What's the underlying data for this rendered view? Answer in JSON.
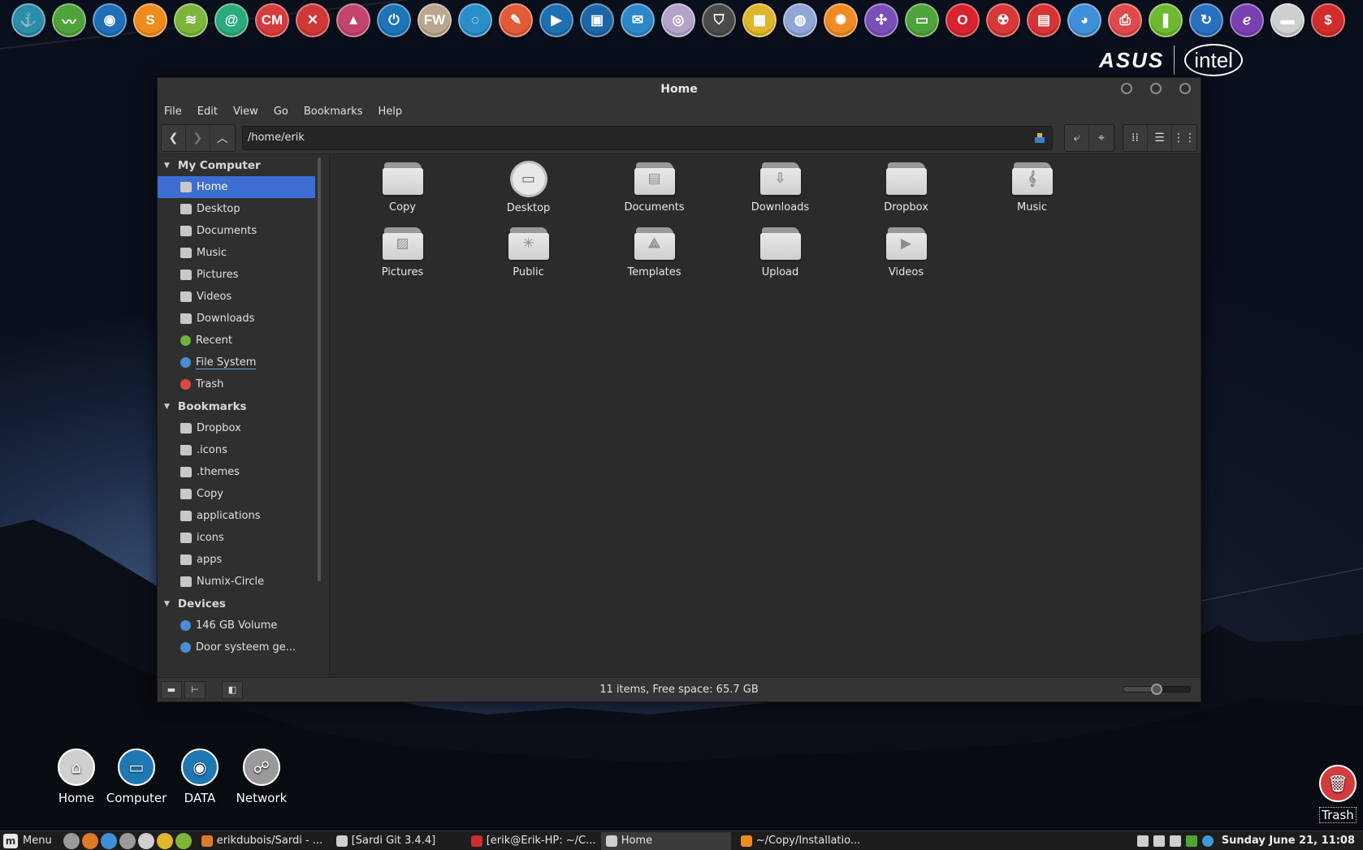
{
  "dock": {
    "icons": [
      {
        "name": "anchor-icon",
        "glyph": "⚓",
        "color": "#2b8da8"
      },
      {
        "name": "system-monitor-icon",
        "glyph": "〰",
        "color": "#4fa33b"
      },
      {
        "name": "firefox-icon",
        "glyph": "◉",
        "color": "#1e6fb8"
      },
      {
        "name": "sublime-icon",
        "glyph": "S",
        "color": "#f08a1d"
      },
      {
        "name": "spotify-icon",
        "glyph": "≋",
        "color": "#7db53c"
      },
      {
        "name": "mail-icon",
        "glyph": "@",
        "color": "#2bab7c"
      },
      {
        "name": "cm-icon",
        "glyph": "CM",
        "color": "#d83b3b"
      },
      {
        "name": "tools-icon",
        "glyph": "✕",
        "color": "#d03838"
      },
      {
        "name": "inkscape-icon",
        "glyph": "▲",
        "color": "#c0446b"
      },
      {
        "name": "power-icon",
        "glyph": "⏻",
        "color": "#1e74b8"
      },
      {
        "name": "fw-icon",
        "glyph": "FW",
        "color": "#b8a68e"
      },
      {
        "name": "dotted-circle-icon",
        "glyph": "◌",
        "color": "#2a8ec9"
      },
      {
        "name": "pencil-icon",
        "glyph": "✎",
        "color": "#e05b36"
      },
      {
        "name": "video-editor-icon",
        "glyph": "▶",
        "color": "#1f6fb3"
      },
      {
        "name": "image-viewer-icon",
        "glyph": "▣",
        "color": "#1d66a6"
      },
      {
        "name": "thunderbird-icon",
        "glyph": "✉",
        "color": "#2c88c9"
      },
      {
        "name": "disc-icon",
        "glyph": "◎",
        "color": "#b3a3c9"
      },
      {
        "name": "shield-icon",
        "glyph": "⛉",
        "color": "#4a4a4a"
      },
      {
        "name": "ruler-icon",
        "glyph": "▦",
        "color": "#e0b62a"
      },
      {
        "name": "globe-icon",
        "glyph": "◍",
        "color": "#8fa6d6"
      },
      {
        "name": "orange-wheel-icon",
        "glyph": "✺",
        "color": "#ef8b23"
      },
      {
        "name": "compass-icon",
        "glyph": "✣",
        "color": "#7a4fb8"
      },
      {
        "name": "card-icon",
        "glyph": "▭",
        "color": "#4ea33a"
      },
      {
        "name": "opera-icon",
        "glyph": "O",
        "color": "#d8232f"
      },
      {
        "name": "radiation-icon",
        "glyph": "☢",
        "color": "#d83838"
      },
      {
        "name": "grid-apps-icon",
        "glyph": "▤",
        "color": "#d63333"
      },
      {
        "name": "chrome-icon",
        "glyph": "◕",
        "color": "#3f8fd8"
      },
      {
        "name": "printer-icon",
        "glyph": "⎙",
        "color": "#e04a4a"
      },
      {
        "name": "book-icon",
        "glyph": "❚",
        "color": "#6fb832"
      },
      {
        "name": "refresh-icon",
        "glyph": "↻",
        "color": "#2a6fc0"
      },
      {
        "name": "emacs-icon",
        "glyph": "ℯ",
        "color": "#7a3fb0"
      },
      {
        "name": "folder-dock-icon",
        "glyph": "▬",
        "color": "#cfcfcf"
      },
      {
        "name": "terminal-dollar-icon",
        "glyph": "$",
        "color": "#d02c2c"
      }
    ]
  },
  "brand": {
    "asus": "ASUS",
    "intel": "intel"
  },
  "window": {
    "title": "Home",
    "menu": [
      "File",
      "Edit",
      "View",
      "Go",
      "Bookmarks",
      "Help"
    ],
    "path": "/home/erik",
    "status": "11 items, Free space: 65.7 GB",
    "zoom_level": 0.5
  },
  "sidebar": {
    "sections": [
      {
        "title": "My Computer",
        "items": [
          {
            "label": "Home",
            "icon": "home-icon",
            "kind": "folder",
            "selected": true
          },
          {
            "label": "Desktop",
            "icon": "desktop-icon",
            "kind": "folder"
          },
          {
            "label": "Documents",
            "icon": "documents-icon",
            "kind": "folder"
          },
          {
            "label": "Music",
            "icon": "music-icon",
            "kind": "folder"
          },
          {
            "label": "Pictures",
            "icon": "pictures-icon",
            "kind": "folder"
          },
          {
            "label": "Videos",
            "icon": "videos-icon",
            "kind": "folder"
          },
          {
            "label": "Downloads",
            "icon": "downloads-icon",
            "kind": "folder"
          },
          {
            "label": "Recent",
            "icon": "recent-icon",
            "kind": "green"
          },
          {
            "label": "File System",
            "icon": "drive-icon",
            "kind": "blue"
          },
          {
            "label": "Trash",
            "icon": "trash-icon",
            "kind": "red"
          }
        ]
      },
      {
        "title": "Bookmarks",
        "items": [
          {
            "label": "Dropbox",
            "icon": "folder-icon",
            "kind": "folder"
          },
          {
            "label": ".icons",
            "icon": "folder-icon",
            "kind": "folder"
          },
          {
            "label": ".themes",
            "icon": "folder-icon",
            "kind": "folder"
          },
          {
            "label": "Copy",
            "icon": "folder-icon",
            "kind": "folder"
          },
          {
            "label": "applications",
            "icon": "folder-icon",
            "kind": "folder"
          },
          {
            "label": "icons",
            "icon": "folder-icon",
            "kind": "folder"
          },
          {
            "label": "apps",
            "icon": "folder-icon",
            "kind": "folder"
          },
          {
            "label": "Numix-Circle",
            "icon": "folder-icon",
            "kind": "folder"
          }
        ]
      },
      {
        "title": "Devices",
        "items": [
          {
            "label": "146 GB Volume",
            "icon": "drive-icon",
            "kind": "blue"
          },
          {
            "label": "Door systeem ge...",
            "icon": "drive-icon",
            "kind": "blue"
          }
        ]
      }
    ]
  },
  "files": [
    {
      "label": "Copy",
      "glyph": ""
    },
    {
      "label": "Desktop",
      "glyph": "▭",
      "special": true
    },
    {
      "label": "Documents",
      "glyph": "▤"
    },
    {
      "label": "Downloads",
      "glyph": "⇩"
    },
    {
      "label": "Dropbox",
      "glyph": ""
    },
    {
      "label": "Music",
      "glyph": "𝄞"
    },
    {
      "label": "Pictures",
      "glyph": "▨"
    },
    {
      "label": "Public",
      "glyph": "✳"
    },
    {
      "label": "Templates",
      "glyph": "⟁"
    },
    {
      "label": "Upload",
      "glyph": ""
    },
    {
      "label": "Videos",
      "glyph": "▶"
    }
  ],
  "desktop_icons": [
    {
      "label": "Home",
      "icon": "home-desktop-icon",
      "glyph": "⌂",
      "color": "#cfcfcf"
    },
    {
      "label": "Computer",
      "icon": "computer-desktop-icon",
      "glyph": "▭",
      "color": "#1f78b4"
    },
    {
      "label": "DATA",
      "icon": "data-drive-desktop-icon",
      "glyph": "◉",
      "color": "#1f78b4"
    },
    {
      "label": "Network",
      "icon": "network-desktop-icon",
      "glyph": "☍",
      "color": "#9a9a9a"
    }
  ],
  "desktop_trash": {
    "label": "Trash"
  },
  "panel": {
    "menu_label": "Menu",
    "launchers": [
      "#9a9a9a",
      "#e0782a",
      "#3f8fd8",
      "#9a9a9a",
      "#cfcfcf",
      "#e0b62a",
      "#7db53c"
    ],
    "tasks": [
      {
        "label": "erikdubois/Sardi - ...",
        "color": "#e0782a"
      },
      {
        "label": "[Sardi Git 3.4.4]",
        "color": "#cfcfcf"
      },
      {
        "label": "[erik@Erik-HP: ~/C...",
        "color": "#d02c2c"
      },
      {
        "label": "Home",
        "color": "#cfcfcf",
        "active": true
      },
      {
        "label": "~/Copy/Installatio...",
        "color": "#f08a1d"
      }
    ],
    "clock": "Sunday June 21, 11:08"
  }
}
